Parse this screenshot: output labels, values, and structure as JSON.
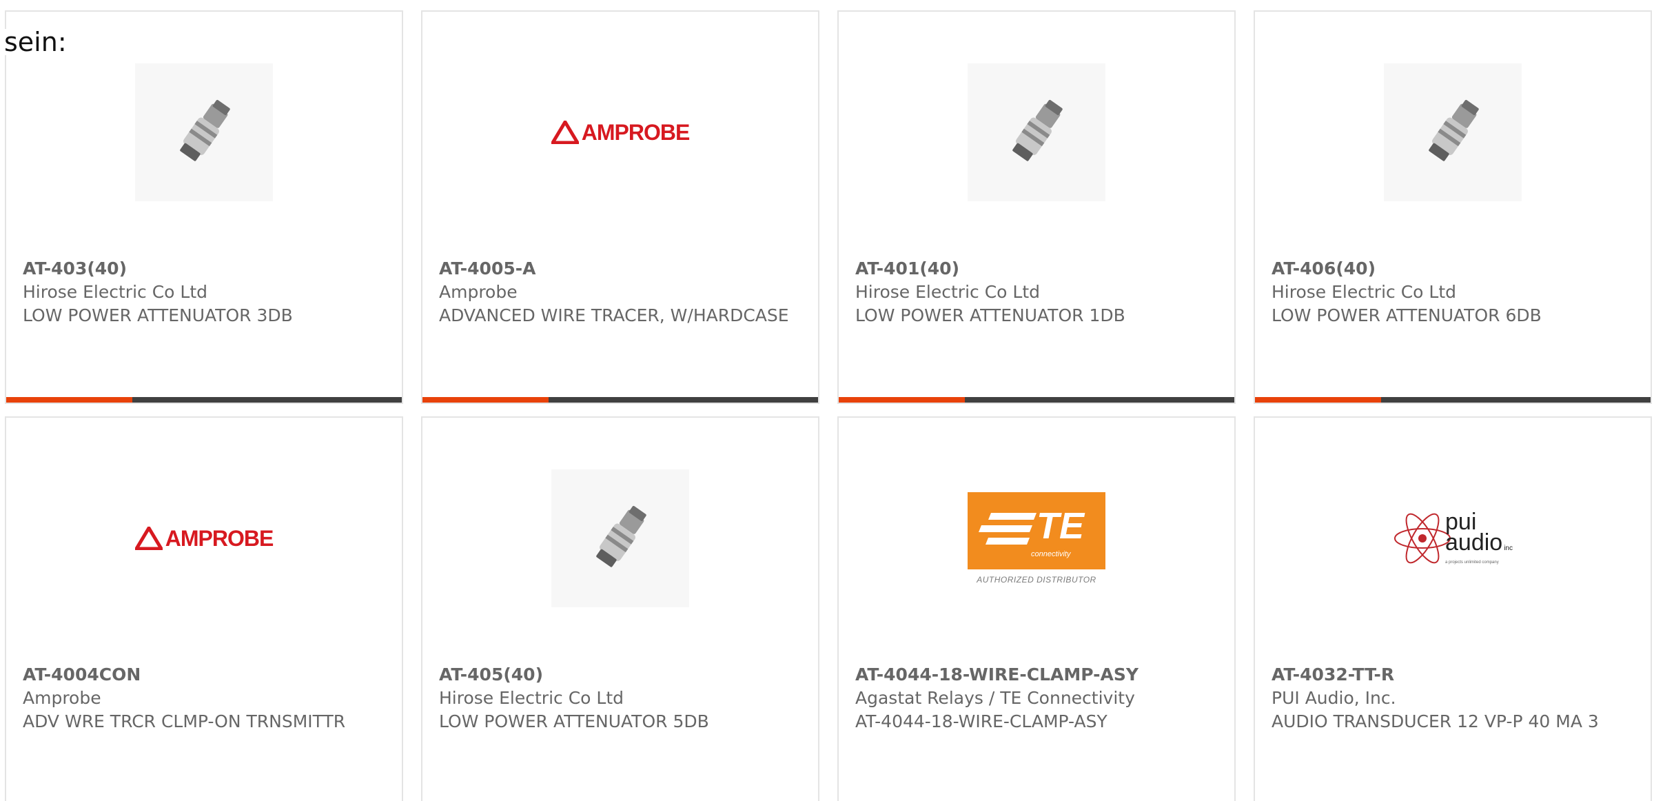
{
  "intro_text": "sein:",
  "products": [
    {
      "part_number": "AT-403(40)",
      "manufacturer": "Hirose Electric Co Ltd",
      "description": "LOW POWER ATTENUATOR 3DB",
      "image": "attenuator-photo"
    },
    {
      "part_number": "AT-4005-A",
      "manufacturer": "Amprobe",
      "description": "ADVANCED WIRE TRACER, W/HARDCASE",
      "image": "amprobe-logo"
    },
    {
      "part_number": "AT-401(40)",
      "manufacturer": "Hirose Electric Co Ltd",
      "description": "LOW POWER ATTENUATOR 1DB",
      "image": "attenuator-photo"
    },
    {
      "part_number": "AT-406(40)",
      "manufacturer": "Hirose Electric Co Ltd",
      "description": "LOW POWER ATTENUATOR 6DB",
      "image": "attenuator-photo"
    },
    {
      "part_number": "AT-4004CON",
      "manufacturer": "Amprobe",
      "description": "ADV WRE TRCR CLMP-ON TRNSMITTR",
      "image": "amprobe-logo"
    },
    {
      "part_number": "AT-405(40)",
      "manufacturer": "Hirose Electric Co Ltd",
      "description": "LOW POWER ATTENUATOR 5DB",
      "image": "attenuator-photo"
    },
    {
      "part_number": "AT-4044-18-WIRE-CLAMP-ASY",
      "manufacturer": "Agastat Relays / TE Connectivity",
      "description": "AT-4044-18-WIRE-CLAMP-ASY",
      "image": "te-connectivity-logo"
    },
    {
      "part_number": "AT-4032-TT-R",
      "manufacturer": "PUI Audio, Inc.",
      "description": "AUDIO TRANSDUCER 12 VP-P 40 MA 3",
      "image": "pui-audio-logo"
    }
  ],
  "logos": {
    "amprobe": "AMPROBE",
    "te_word": "TE",
    "te_sub": "connectivity",
    "te_caption": "AUTHORIZED DISTRIBUTOR",
    "pui_line1": "pui",
    "pui_line2": "audio",
    "pui_inc": "inc",
    "pui_tagline": "a projects unlimited company"
  },
  "colors": {
    "accent": "#e8420a",
    "bar": "#404040",
    "text": "#666666",
    "amprobe_red": "#d71920",
    "te_orange": "#f28c1e"
  }
}
